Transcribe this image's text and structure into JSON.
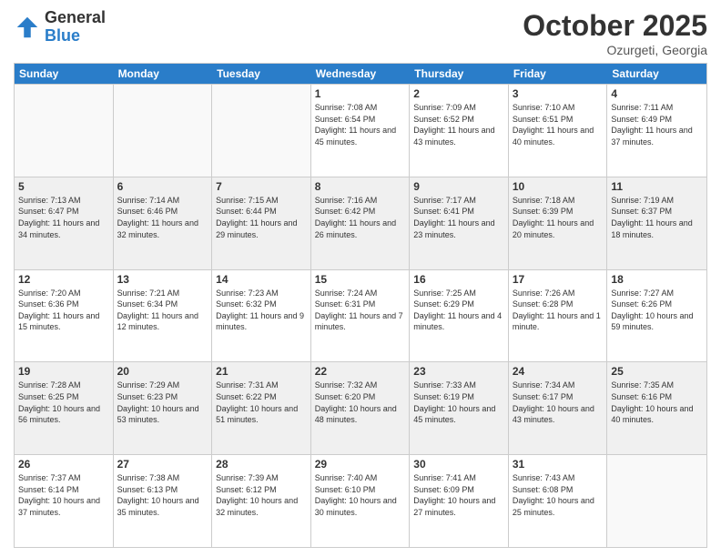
{
  "logo": {
    "general": "General",
    "blue": "Blue"
  },
  "header": {
    "month": "October 2025",
    "location": "Ozurgeti, Georgia"
  },
  "weekdays": [
    "Sunday",
    "Monday",
    "Tuesday",
    "Wednesday",
    "Thursday",
    "Friday",
    "Saturday"
  ],
  "rows": [
    [
      {
        "day": "",
        "info": "",
        "empty": true
      },
      {
        "day": "",
        "info": "",
        "empty": true
      },
      {
        "day": "",
        "info": "",
        "empty": true
      },
      {
        "day": "1",
        "info": "Sunrise: 7:08 AM\nSunset: 6:54 PM\nDaylight: 11 hours and 45 minutes."
      },
      {
        "day": "2",
        "info": "Sunrise: 7:09 AM\nSunset: 6:52 PM\nDaylight: 11 hours and 43 minutes."
      },
      {
        "day": "3",
        "info": "Sunrise: 7:10 AM\nSunset: 6:51 PM\nDaylight: 11 hours and 40 minutes."
      },
      {
        "day": "4",
        "info": "Sunrise: 7:11 AM\nSunset: 6:49 PM\nDaylight: 11 hours and 37 minutes."
      }
    ],
    [
      {
        "day": "5",
        "info": "Sunrise: 7:13 AM\nSunset: 6:47 PM\nDaylight: 11 hours and 34 minutes."
      },
      {
        "day": "6",
        "info": "Sunrise: 7:14 AM\nSunset: 6:46 PM\nDaylight: 11 hours and 32 minutes."
      },
      {
        "day": "7",
        "info": "Sunrise: 7:15 AM\nSunset: 6:44 PM\nDaylight: 11 hours and 29 minutes."
      },
      {
        "day": "8",
        "info": "Sunrise: 7:16 AM\nSunset: 6:42 PM\nDaylight: 11 hours and 26 minutes."
      },
      {
        "day": "9",
        "info": "Sunrise: 7:17 AM\nSunset: 6:41 PM\nDaylight: 11 hours and 23 minutes."
      },
      {
        "day": "10",
        "info": "Sunrise: 7:18 AM\nSunset: 6:39 PM\nDaylight: 11 hours and 20 minutes."
      },
      {
        "day": "11",
        "info": "Sunrise: 7:19 AM\nSunset: 6:37 PM\nDaylight: 11 hours and 18 minutes."
      }
    ],
    [
      {
        "day": "12",
        "info": "Sunrise: 7:20 AM\nSunset: 6:36 PM\nDaylight: 11 hours and 15 minutes."
      },
      {
        "day": "13",
        "info": "Sunrise: 7:21 AM\nSunset: 6:34 PM\nDaylight: 11 hours and 12 minutes."
      },
      {
        "day": "14",
        "info": "Sunrise: 7:23 AM\nSunset: 6:32 PM\nDaylight: 11 hours and 9 minutes."
      },
      {
        "day": "15",
        "info": "Sunrise: 7:24 AM\nSunset: 6:31 PM\nDaylight: 11 hours and 7 minutes."
      },
      {
        "day": "16",
        "info": "Sunrise: 7:25 AM\nSunset: 6:29 PM\nDaylight: 11 hours and 4 minutes."
      },
      {
        "day": "17",
        "info": "Sunrise: 7:26 AM\nSunset: 6:28 PM\nDaylight: 11 hours and 1 minute."
      },
      {
        "day": "18",
        "info": "Sunrise: 7:27 AM\nSunset: 6:26 PM\nDaylight: 10 hours and 59 minutes."
      }
    ],
    [
      {
        "day": "19",
        "info": "Sunrise: 7:28 AM\nSunset: 6:25 PM\nDaylight: 10 hours and 56 minutes."
      },
      {
        "day": "20",
        "info": "Sunrise: 7:29 AM\nSunset: 6:23 PM\nDaylight: 10 hours and 53 minutes."
      },
      {
        "day": "21",
        "info": "Sunrise: 7:31 AM\nSunset: 6:22 PM\nDaylight: 10 hours and 51 minutes."
      },
      {
        "day": "22",
        "info": "Sunrise: 7:32 AM\nSunset: 6:20 PM\nDaylight: 10 hours and 48 minutes."
      },
      {
        "day": "23",
        "info": "Sunrise: 7:33 AM\nSunset: 6:19 PM\nDaylight: 10 hours and 45 minutes."
      },
      {
        "day": "24",
        "info": "Sunrise: 7:34 AM\nSunset: 6:17 PM\nDaylight: 10 hours and 43 minutes."
      },
      {
        "day": "25",
        "info": "Sunrise: 7:35 AM\nSunset: 6:16 PM\nDaylight: 10 hours and 40 minutes."
      }
    ],
    [
      {
        "day": "26",
        "info": "Sunrise: 7:37 AM\nSunset: 6:14 PM\nDaylight: 10 hours and 37 minutes."
      },
      {
        "day": "27",
        "info": "Sunrise: 7:38 AM\nSunset: 6:13 PM\nDaylight: 10 hours and 35 minutes."
      },
      {
        "day": "28",
        "info": "Sunrise: 7:39 AM\nSunset: 6:12 PM\nDaylight: 10 hours and 32 minutes."
      },
      {
        "day": "29",
        "info": "Sunrise: 7:40 AM\nSunset: 6:10 PM\nDaylight: 10 hours and 30 minutes."
      },
      {
        "day": "30",
        "info": "Sunrise: 7:41 AM\nSunset: 6:09 PM\nDaylight: 10 hours and 27 minutes."
      },
      {
        "day": "31",
        "info": "Sunrise: 7:43 AM\nSunset: 6:08 PM\nDaylight: 10 hours and 25 minutes."
      },
      {
        "day": "",
        "info": "",
        "empty": true
      }
    ]
  ]
}
